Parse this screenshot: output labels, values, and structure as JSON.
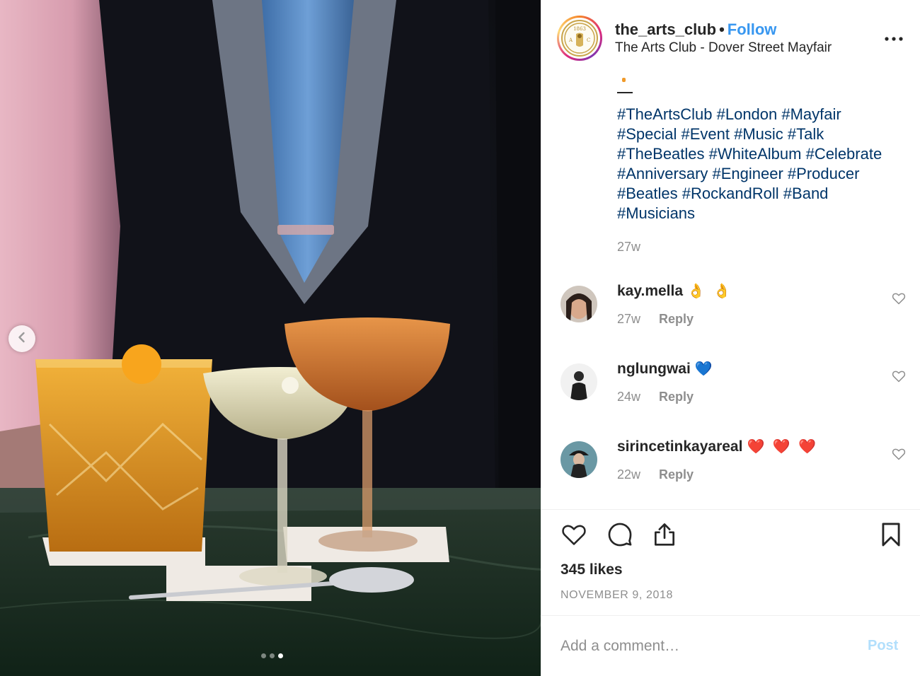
{
  "post": {
    "username": "the_arts_club",
    "separator": "•",
    "follow_label": "Follow",
    "location": "The Arts Club - Dover Street Mayfair",
    "avatar_text": "1863"
  },
  "caption": {
    "hashtag_lines": [
      "#TheArtsClub #London #Mayfair",
      "#Special #Event #Music #Talk",
      "#TheBeatles #WhiteAlbum #Celebrate",
      "#Anniversary #Engineer #Producer",
      "#Beatles #RockandRoll #Band",
      "#Musicians"
    ],
    "time": "27w"
  },
  "comments": [
    {
      "user": "kay.mella",
      "text": "👌 👌",
      "time": "27w",
      "reply_label": "Reply"
    },
    {
      "user": "nglungwai",
      "text": "💙",
      "time": "24w",
      "reply_label": "Reply"
    },
    {
      "user": "sirincetinkayareal",
      "text": "❤️ ❤️ ❤️",
      "time": "22w",
      "reply_label": "Reply"
    }
  ],
  "engagement": {
    "likes": "345 likes",
    "date": "NOVEMBER 9, 2018"
  },
  "comment_box": {
    "placeholder": "Add a comment…",
    "post_label": "Post"
  },
  "carousel": {
    "slide_count": 3,
    "active_index": 2
  },
  "icons": {
    "prev": "chevron-left-icon",
    "more": "more-options-icon",
    "like": "heart-icon",
    "comment": "comment-bubble-icon",
    "share": "share-icon",
    "save": "bookmark-icon"
  },
  "colors": {
    "link": "#3897f0",
    "hashtag": "#003569",
    "muted": "#8e8e8e",
    "post_disabled": "#b2dffc"
  }
}
